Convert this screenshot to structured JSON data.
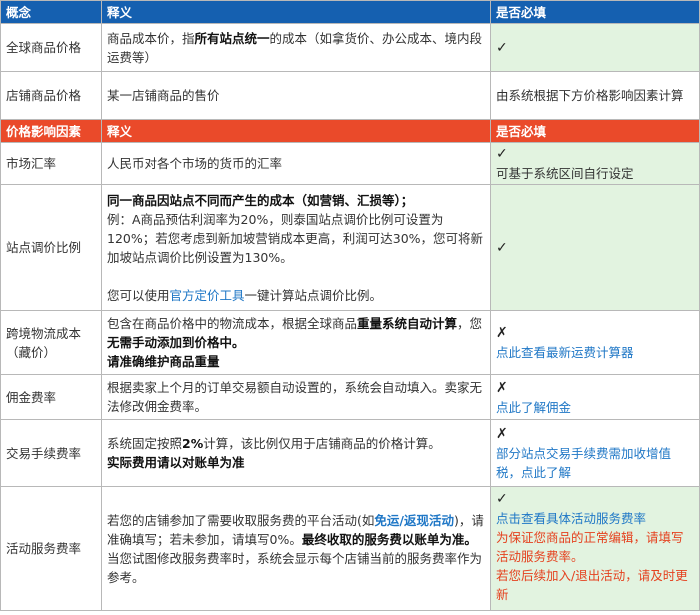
{
  "header1": {
    "concept": "概念",
    "meaning": "释义",
    "required": "是否必填"
  },
  "global_price": {
    "concept": "全球商品价格",
    "m1": "商品成本价，指",
    "m2": "所有站点统一",
    "m3": "的成本（如拿货价、办公成本、境内段运费等）",
    "required": "✓"
  },
  "shop_price": {
    "concept": "店铺商品价格",
    "meaning": "某一店铺商品的售价",
    "required": "由系统根据下方价格影响因素计算"
  },
  "header2": {
    "concept": "价格影响因素",
    "meaning": "释义",
    "required": "是否必填"
  },
  "fx": {
    "concept": "市场汇率",
    "meaning": "人民币对各个市场的货币的汇率",
    "mark": "✓",
    "note": "可基于系统区间自行设定"
  },
  "site_adjust": {
    "concept": "站点调价比例",
    "bold": "同一商品因站点不同而产生的成本（如营销、汇损等）；",
    "example": "例：A商品预估利润率为20%，则泰国站点调价比例可设置为120%；若您考虑到新加坡营销成本更高，利润可达30%，您可将新加坡站点调价比例设置为130%。",
    "tool_pre": "您可以使用",
    "tool_link": "官方定价工具",
    "tool_post": "一键计算站点调价比例。",
    "mark": "✓"
  },
  "logistics": {
    "concept": "跨境物流成本（藏价）",
    "m1": "包含在商品价格中的物流成本，根据全球商品",
    "m2": "重量系统自动计算",
    "m3": "，您",
    "m4": "无需手动添加到价格中。",
    "m5": "请准确维护商品重量",
    "mark": "✗",
    "link": "点此查看最新运费计算器"
  },
  "commission": {
    "concept": "佣金费率",
    "meaning": "根据卖家上个月的订单交易额自动设置的，系统会自动填入。卖家无法修改佣金费率。",
    "mark": "✗",
    "link": "点此了解佣金"
  },
  "transaction": {
    "concept": "交易手续费率",
    "m1": "系统固定按照",
    "m2": "2%",
    "m3": "计算，该比例仅用于店铺商品的价格计算。",
    "m4": "实际费用请以对账单为准",
    "mark": "✗",
    "link": "部分站点交易手续费需加收增值税，点此了解"
  },
  "service": {
    "concept": "活动服务费率",
    "m1": "若您的店铺参加了需要收取服务费的平台活动(如",
    "m2": "免运/返现活动",
    "m3": ")，请准确填写；若未参加，请填写0%。",
    "m4": "最终收取的服务费以账单为准。",
    "m5": "当您试图修改服务费率时，系统会显示每个店铺当前的服务费率作为参考。",
    "mark": "✓",
    "link": "点击查看具体活动服务费率",
    "red1": "为保证您商品的正常编辑，请填写活动服务费率。",
    "red2": "若您后续加入/退出活动，请及时更新"
  }
}
